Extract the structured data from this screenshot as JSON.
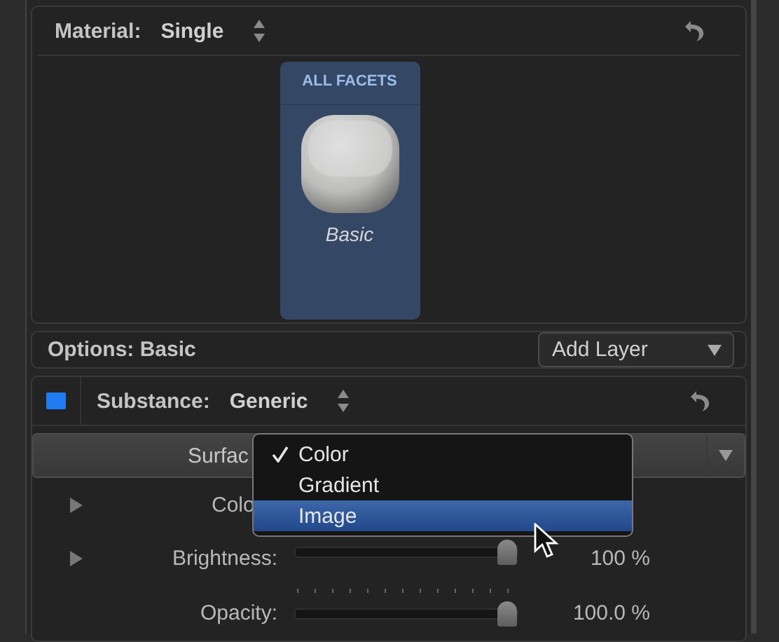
{
  "material": {
    "label": "Material:",
    "value": "Single"
  },
  "facet_card": {
    "header": "ALL FACETS",
    "name": "Basic",
    "selected": true
  },
  "options": {
    "label": "Options: Basic",
    "button": "Add Layer"
  },
  "substance": {
    "label": "Substance:",
    "value": "Generic",
    "enabled": true
  },
  "surface": {
    "label": "Surfac"
  },
  "params": [
    {
      "kind": "text",
      "label": "Colo",
      "expanded": false
    },
    {
      "kind": "slider",
      "label": "Brightness:",
      "expanded": false,
      "level": 0.95,
      "reading": "100 %"
    },
    {
      "kind": "slider",
      "label": "Opacity:",
      "level": 0.95,
      "reading": "100.0 %",
      "ticks": true
    }
  ],
  "menu": {
    "items": [
      {
        "label": "Color",
        "checked": true,
        "selected": false
      },
      {
        "label": "Gradient",
        "checked": false,
        "selected": false
      },
      {
        "label": "Image",
        "checked": false,
        "selected": true
      }
    ]
  }
}
